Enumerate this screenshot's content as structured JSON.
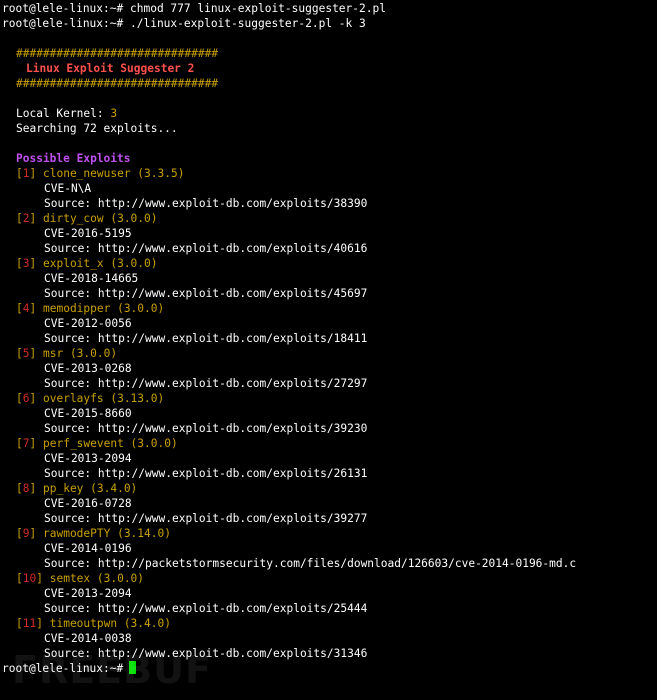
{
  "commands": [
    {
      "prompt": "root@lele-linux:~#",
      "text": "chmod 777 linux-exploit-suggester-2.pl"
    },
    {
      "prompt": "root@lele-linux:~#",
      "text": "./linux-exploit-suggester-2.pl -k 3"
    }
  ],
  "banner": {
    "hashes": "##############################",
    "title": "Linux Exploit Suggester 2"
  },
  "info": {
    "kernel_label": "Local Kernel:",
    "kernel_value": "3",
    "searching": "Searching 72 exploits..."
  },
  "section_title": "Possible Exploits",
  "exploits": [
    {
      "num": "1",
      "name": "clone_newuser (3.3.5)",
      "cve": "CVE-N\\A",
      "source": "Source: http://www.exploit-db.com/exploits/38390"
    },
    {
      "num": "2",
      "name": "dirty_cow (3.0.0)",
      "cve": "CVE-2016-5195",
      "source": "Source: http://www.exploit-db.com/exploits/40616"
    },
    {
      "num": "3",
      "name": "exploit_x (3.0.0)",
      "cve": "CVE-2018-14665",
      "source": "Source: http://www.exploit-db.com/exploits/45697"
    },
    {
      "num": "4",
      "name": "memodipper (3.0.0)",
      "cve": "CVE-2012-0056",
      "source": "Source: http://www.exploit-db.com/exploits/18411"
    },
    {
      "num": "5",
      "name": "msr (3.0.0)",
      "cve": "CVE-2013-0268",
      "source": "Source: http://www.exploit-db.com/exploits/27297"
    },
    {
      "num": "6",
      "name": "overlayfs (3.13.0)",
      "cve": "CVE-2015-8660",
      "source": "Source: http://www.exploit-db.com/exploits/39230"
    },
    {
      "num": "7",
      "name": "perf_swevent (3.0.0)",
      "cve": "CVE-2013-2094",
      "source": "Source: http://www.exploit-db.com/exploits/26131"
    },
    {
      "num": "8",
      "name": "pp_key (3.4.0)",
      "cve": "CVE-2016-0728",
      "source": "Source: http://www.exploit-db.com/exploits/39277"
    },
    {
      "num": "9",
      "name": "rawmodePTY (3.14.0)",
      "cve": "CVE-2014-0196",
      "source": "Source: http://packetstormsecurity.com/files/download/126603/cve-2014-0196-md.c"
    },
    {
      "num": "10",
      "name": "semtex (3.0.0)",
      "cve": "CVE-2013-2094",
      "source": "Source: http://www.exploit-db.com/exploits/25444"
    },
    {
      "num": "11",
      "name": "timeoutpwn (3.4.0)",
      "cve": "CVE-2014-0038",
      "source": "Source: http://www.exploit-db.com/exploits/31346"
    }
  ],
  "final_prompt": "root@lele-linux:~#",
  "watermark": "FREEBUF",
  "colors": {
    "background": "#000000",
    "text": "#ffffff",
    "accent_yellow": "#c8a000",
    "title_red": "#ff5050",
    "number_red": "#d22a2a",
    "section_magenta": "#c050f0",
    "cursor_green": "#00e000"
  }
}
